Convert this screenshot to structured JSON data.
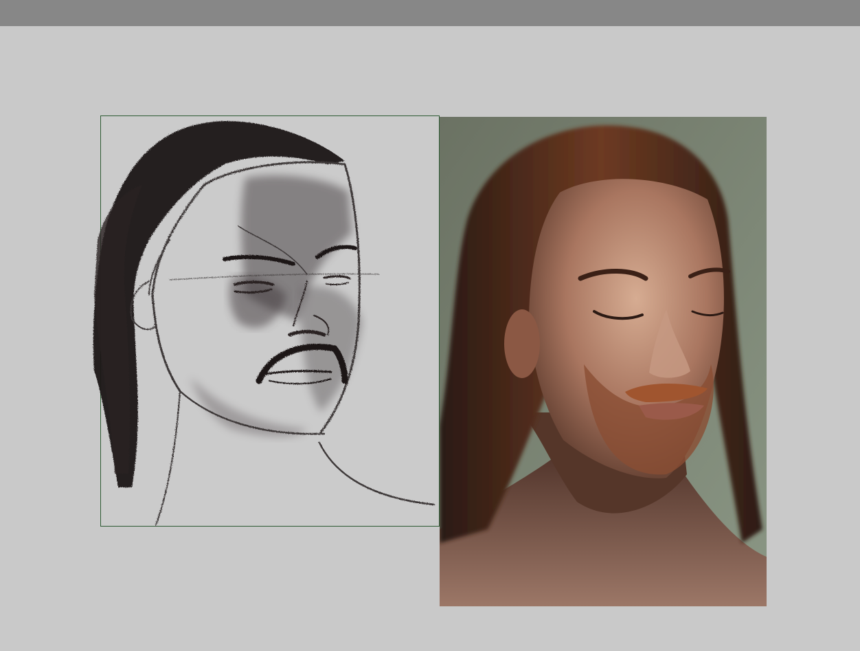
{
  "app": {
    "title": ""
  },
  "canvas": {
    "layers": [
      {
        "name": "sketch-drawing"
      },
      {
        "name": "reference-image"
      }
    ]
  },
  "colors": {
    "toolbar": "#878787",
    "workspace": "#c9c9c9",
    "canvas_border": "#2d5a33",
    "charcoal": "#1e1819",
    "photo_background": "#6f776b",
    "hair": "#3a2318",
    "skin": "#b0826a"
  }
}
